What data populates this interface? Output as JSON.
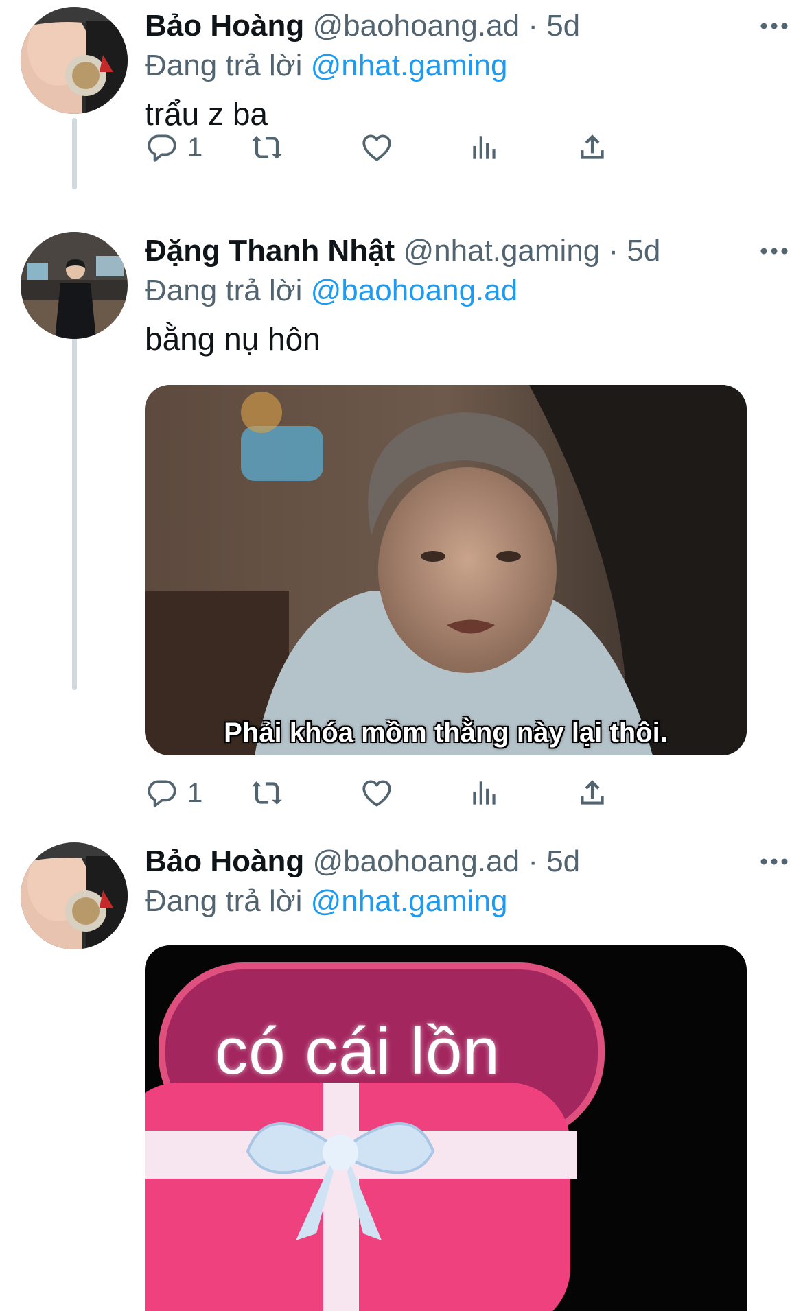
{
  "thread": [
    {
      "display_name": "Bảo Hoàng",
      "handle": "@baohoang.ad",
      "separator": "·",
      "time": "5d",
      "reply_prefix": "Đang trả lời",
      "reply_to": "@nhat.gaming",
      "text": "trẩu z ba",
      "reply_count": "1",
      "avatar": "avatar-bao-hoang"
    },
    {
      "display_name": "Đặng Thanh Nhật",
      "handle": "@nhat.gaming",
      "separator": "·",
      "time": "5d",
      "reply_prefix": "Đang trả lời",
      "reply_to": "@baohoang.ad",
      "text": "bằng nụ hôn",
      "reply_count": "1",
      "avatar": "avatar-dang-thanh-nhat",
      "media_caption": "Phải khóa mồm thằng này lại thôi."
    },
    {
      "display_name": "Bảo Hoàng",
      "handle": "@baohoang.ad",
      "separator": "·",
      "time": "5d",
      "reply_prefix": "Đang trả lời",
      "reply_to": "@nhat.gaming",
      "avatar": "avatar-bao-hoang",
      "media_caption": "có cái lồn"
    }
  ],
  "icons": {
    "reply": "reply-icon",
    "retweet": "retweet-icon",
    "like": "heart-icon",
    "views": "views-icon",
    "share": "share-icon",
    "more": "more-icon"
  },
  "colors": {
    "link": "#1d9bf0",
    "secondary": "#536471",
    "thread_line": "#cfd9de"
  }
}
